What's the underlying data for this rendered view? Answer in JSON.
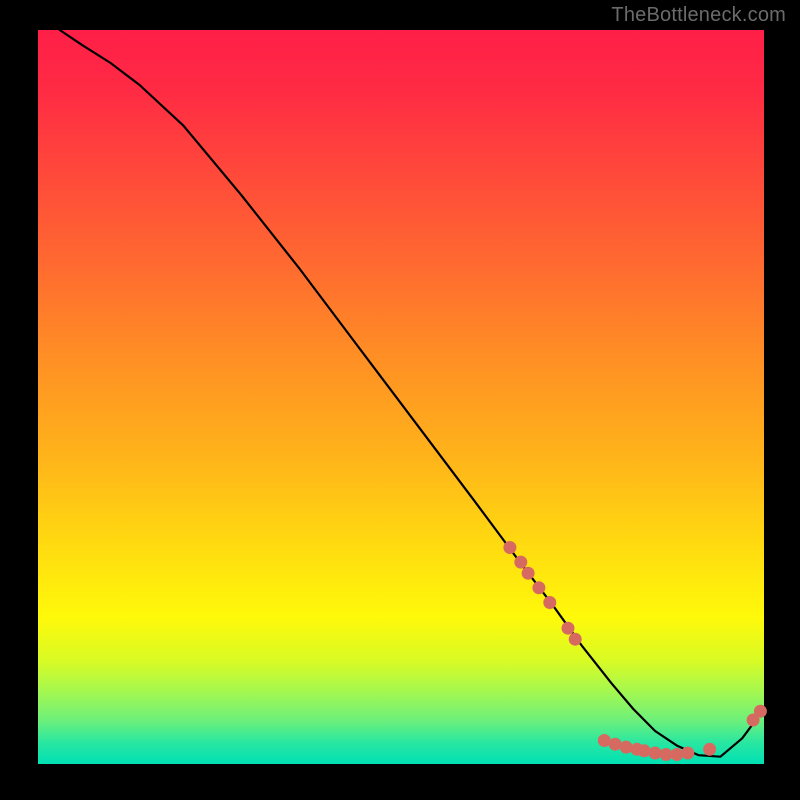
{
  "watermark": "TheBottleneck.com",
  "chart_data": {
    "type": "line",
    "title": "",
    "xlabel": "",
    "ylabel": "",
    "xlim": [
      0,
      100
    ],
    "ylim": [
      0,
      100
    ],
    "grid": false,
    "legend": false,
    "series": [
      {
        "name": "curve",
        "x": [
          3,
          6,
          10,
          14,
          20,
          28,
          36,
          44,
          52,
          60,
          66,
          71,
          75,
          79,
          82,
          85,
          88,
          91,
          94,
          97,
          100
        ],
        "y": [
          100,
          98,
          95.5,
          92.5,
          87,
          77.5,
          67.5,
          57,
          46.5,
          36,
          28,
          21.5,
          16,
          11,
          7.5,
          4.5,
          2.5,
          1.2,
          1.0,
          3.5,
          7.5
        ]
      }
    ],
    "points": [
      {
        "x": 65,
        "y": 29.5
      },
      {
        "x": 66.5,
        "y": 27.5
      },
      {
        "x": 67.5,
        "y": 26.0
      },
      {
        "x": 69,
        "y": 24.0
      },
      {
        "x": 70.5,
        "y": 22.0
      },
      {
        "x": 73,
        "y": 18.5
      },
      {
        "x": 74,
        "y": 17.0
      },
      {
        "x": 78,
        "y": 3.2
      },
      {
        "x": 79.5,
        "y": 2.7
      },
      {
        "x": 81,
        "y": 2.3
      },
      {
        "x": 82.5,
        "y": 2.0
      },
      {
        "x": 83.5,
        "y": 1.8
      },
      {
        "x": 85,
        "y": 1.5
      },
      {
        "x": 86.5,
        "y": 1.3
      },
      {
        "x": 88,
        "y": 1.3
      },
      {
        "x": 89.5,
        "y": 1.5
      },
      {
        "x": 92.5,
        "y": 2.0
      },
      {
        "x": 98.5,
        "y": 6.0
      },
      {
        "x": 99.5,
        "y": 7.2
      }
    ],
    "colors": {
      "curve": "#000000",
      "points": "#d76a60",
      "gradient_top": "#ff1f48",
      "gradient_bottom": "#00e0b4"
    }
  }
}
